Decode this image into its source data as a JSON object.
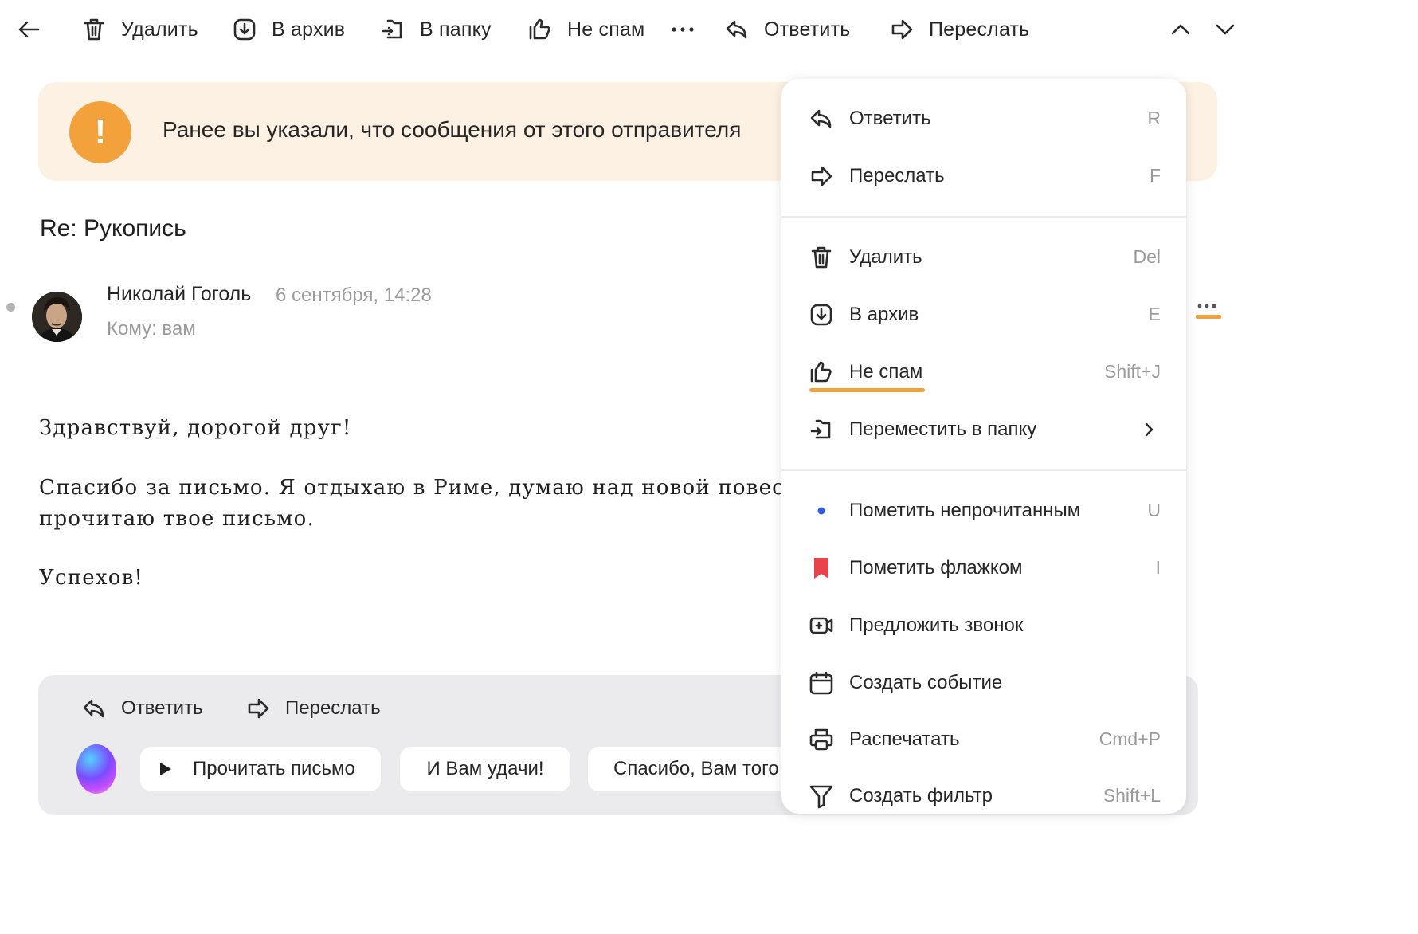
{
  "toolbar": {
    "delete_label": "Удалить",
    "archive_label": "В архив",
    "folder_label": "В папку",
    "notspam_label": "Не спам",
    "reply_label": "Ответить",
    "forward_label": "Переслать"
  },
  "banner": {
    "text": "Ранее вы указали, что сообщения от этого отправителя"
  },
  "email": {
    "subject": "Re: Рукопись",
    "sender_name": "Николай Гоголь",
    "date": "6 сентября, 14:28",
    "to": "Кому: вам",
    "body": {
      "greeting": "Здравствуй, дорогой друг!",
      "line1": "Спасибо за письмо. Я отдыхаю в Риме, думаю над новой повестью",
      "line2": "прочитаю твое письмо.",
      "closing": "Успехов!"
    }
  },
  "bottom": {
    "reply_label": "Ответить",
    "forward_label": "Переслать",
    "chips": [
      "Прочитать письмо",
      "И Вам удачи!",
      "Спасибо, Вам того"
    ]
  },
  "menu": {
    "items": [
      {
        "label": "Ответить",
        "key": "R"
      },
      {
        "label": "Переслать",
        "key": "F"
      },
      {
        "label": "Удалить",
        "key": "Del"
      },
      {
        "label": "В архив",
        "key": "E"
      },
      {
        "label": "Не спам",
        "key": "Shift+J"
      },
      {
        "label": "Переместить в папку",
        "key": ""
      },
      {
        "label": "Пометить непрочитанным",
        "key": "U"
      },
      {
        "label": "Пометить флажком",
        "key": "I"
      },
      {
        "label": "Предложить звонок",
        "key": ""
      },
      {
        "label": "Создать событие",
        "key": ""
      },
      {
        "label": "Распечатать",
        "key": "Cmd+P"
      },
      {
        "label": "Создать фильтр",
        "key": "Shift+L"
      }
    ]
  },
  "colors": {
    "accent_orange": "#f3a13a",
    "banner_bg": "#fdf1e3",
    "unread_blue": "#2f5fe0",
    "flag_red": "#e8434a"
  }
}
